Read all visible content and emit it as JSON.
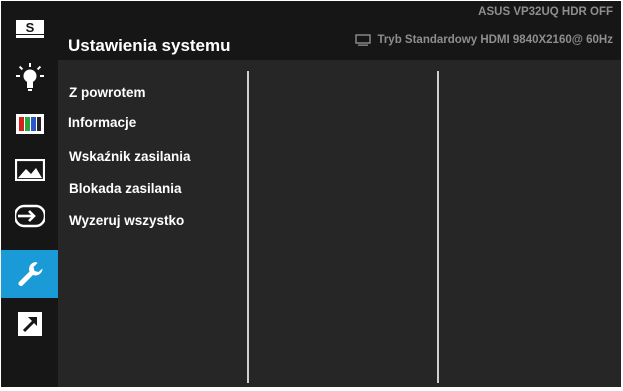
{
  "header": {
    "title": "Ustawienia systemu",
    "status_line1": "ASUS  VP32UQ  HDR OFF",
    "status_line2": "Tryb Standardowy HDMI 9840X2160@ 60Hz",
    "status_icon": "monitor-icon"
  },
  "sidebar": {
    "items": [
      {
        "name": "splendid",
        "icon": "splendid-s-icon"
      },
      {
        "name": "blue-light-filter",
        "icon": "light-bulb-icon"
      },
      {
        "name": "color",
        "icon": "color-bars-icon"
      },
      {
        "name": "image",
        "icon": "image-landscape-icon"
      },
      {
        "name": "input-select",
        "icon": "input-select-icon"
      },
      {
        "name": "system-setup",
        "icon": "wrench-icon",
        "active": true
      },
      {
        "name": "shortcut",
        "icon": "shortcut-arrow-icon"
      }
    ]
  },
  "menu": {
    "items": [
      {
        "label": "Z powrotem"
      },
      {
        "label": "Informacje"
      },
      {
        "label": "Wskaźnik zasilania"
      },
      {
        "label": "Blokada zasilania"
      },
      {
        "label": "Wyzeruj wszystko"
      }
    ]
  },
  "colors": {
    "accent": "#1a9bd7",
    "background": "#262626",
    "header_background": "#161616",
    "text": "#ffffff",
    "status_text": "#8e8e8e"
  }
}
